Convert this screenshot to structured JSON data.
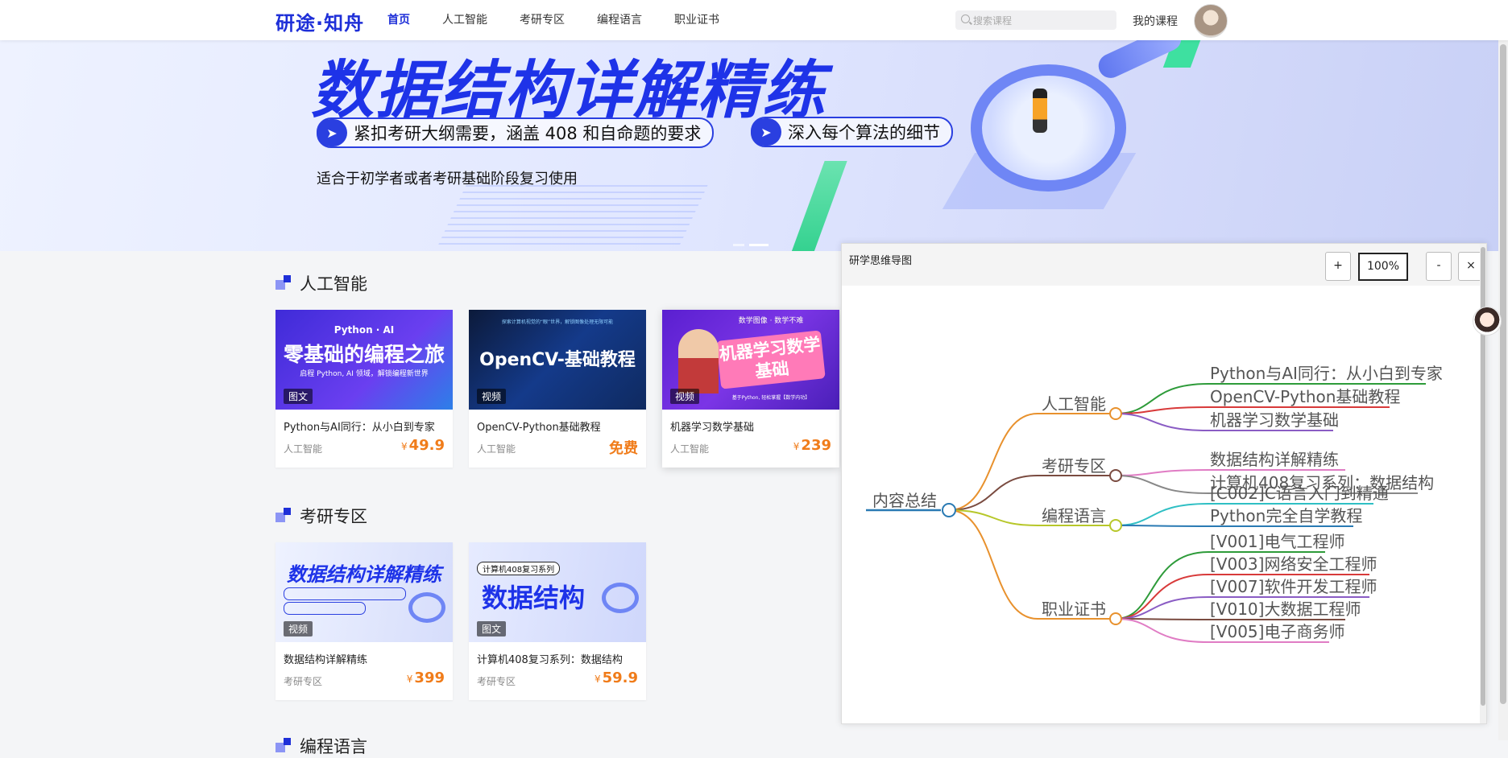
{
  "header": {
    "logo": "研途·知舟",
    "nav": [
      "首页",
      "人工智能",
      "考研专区",
      "编程语言",
      "职业证书"
    ],
    "search_placeholder": "搜索课程",
    "my_courses": "我的课程"
  },
  "banner": {
    "title": "数据结构详解精练",
    "pill1": "紧扣考研大纲需要，涵盖 408 和自命题的要求",
    "pill2": "深入每个算法的细节",
    "subtitle": "适合于初学者或者考研基础阶段复习使用"
  },
  "sections": [
    {
      "title": "人工智能",
      "cards": [
        {
          "thumb": "零基础的编程之旅",
          "thumb_top": "Python · AI",
          "thumb_sub": "启程 Python, AI 领域，解锁编程新世界",
          "badge": "图文",
          "title": "Python与AI同行：从小白到专家",
          "category": "人工智能",
          "currency": "¥",
          "price": "49.9"
        },
        {
          "thumb": "OpenCV-基础教程",
          "thumb_top": "探索计算机视觉的“眼”世界，解锁图像处理无限可能",
          "thumb_sub": "",
          "badge": "视频",
          "title": "OpenCV-Python基础教程",
          "category": "人工智能",
          "currency": "",
          "price": "免费"
        },
        {
          "thumb": "机器学习数学基础",
          "thumb_top": "数学图像 · 数学不难",
          "thumb_sub": "基于Python, 轻松掌握【数学内功】",
          "badge": "视频",
          "title": "机器学习数学基础",
          "category": "人工智能",
          "currency": "¥",
          "price": "239"
        }
      ]
    },
    {
      "title": "考研专区",
      "cards": [
        {
          "thumb": "数据结构详解精练",
          "thumb_top": "",
          "thumb_sub": "",
          "badge": "视频",
          "title": "数据结构详解精练",
          "category": "考研专区",
          "currency": "¥",
          "price": "399"
        },
        {
          "thumb": "数据结构",
          "thumb_top": "计算机408复习系列",
          "thumb_sub": "",
          "badge": "图文",
          "title": "计算机408复习系列：数据结构",
          "category": "考研专区",
          "currency": "¥",
          "price": "59.9"
        }
      ]
    },
    {
      "title": "编程语言"
    }
  ],
  "mindmap_panel": {
    "title": "研学思维导图",
    "zoom_in": "+",
    "zoom_level": "100%",
    "zoom_out": "-",
    "close": "×",
    "root": "内容总结",
    "branches": [
      {
        "label": "人工智能",
        "color": "#e8912d",
        "leaves": [
          {
            "label": "Python与AI同行：从小白到专家",
            "color": "#2e9b3a"
          },
          {
            "label": "OpenCV-Python基础教程",
            "color": "#d83a3a"
          },
          {
            "label": "机器学习数学基础",
            "color": "#8a5cc4"
          }
        ]
      },
      {
        "label": "考研专区",
        "color": "#7a4b40",
        "leaves": [
          {
            "label": "数据结构详解精练",
            "color": "#e07cc4"
          },
          {
            "label": "计算机408复习系列：数据结构",
            "color": "#888888"
          }
        ]
      },
      {
        "label": "编程语言",
        "color": "#b7c72a",
        "leaves": [
          {
            "label": "[C002]C语言入门到精通",
            "color": "#2fbfc4"
          },
          {
            "label": "Python完全自学教程",
            "color": "#2a7ab3"
          }
        ]
      },
      {
        "label": "职业证书",
        "color": "#e8912d",
        "leaves": [
          {
            "label": "[V001]电气工程师",
            "color": "#2e9b3a"
          },
          {
            "label": "[V003]网络安全工程师",
            "color": "#d83a3a"
          },
          {
            "label": "[V007]软件开发工程师",
            "color": "#8a5cc4"
          },
          {
            "label": "[V010]大数据工程师",
            "color": "#7a4b40"
          },
          {
            "label": "[V005]电子商务师",
            "color": "#e07cc4"
          }
        ]
      }
    ]
  }
}
